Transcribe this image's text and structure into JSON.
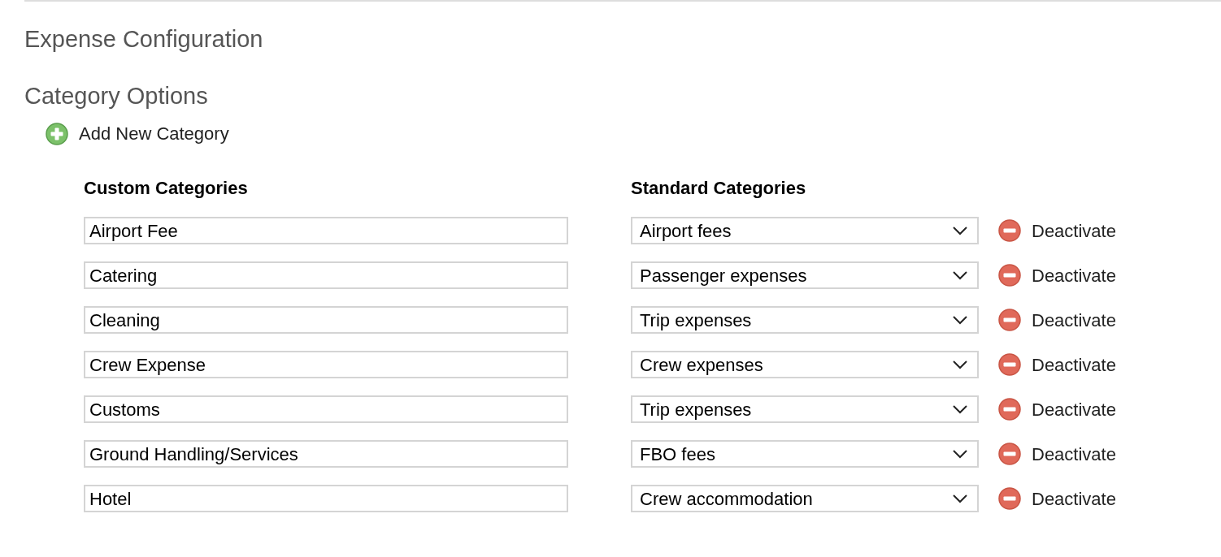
{
  "title": "Expense Configuration",
  "section_title": "Category Options",
  "add_link": "Add New Category",
  "columns": [
    "Custom Categories",
    "Standard Categories"
  ],
  "rows": [
    {
      "custom": "Airport Fee",
      "standard": "Airport fees",
      "action": "Deactivate"
    },
    {
      "custom": "Catering",
      "standard": "Passenger expenses",
      "action": "Deactivate"
    },
    {
      "custom": "Cleaning",
      "standard": "Trip expenses",
      "action": "Deactivate"
    },
    {
      "custom": "Crew Expense",
      "standard": "Crew expenses",
      "action": "Deactivate"
    },
    {
      "custom": "Customs",
      "standard": "Trip expenses",
      "action": "Deactivate"
    },
    {
      "custom": "Ground Handling/Services",
      "standard": "FBO fees",
      "action": "Deactivate"
    },
    {
      "custom": "Hotel",
      "standard": "Crew accommodation",
      "action": "Deactivate"
    }
  ]
}
